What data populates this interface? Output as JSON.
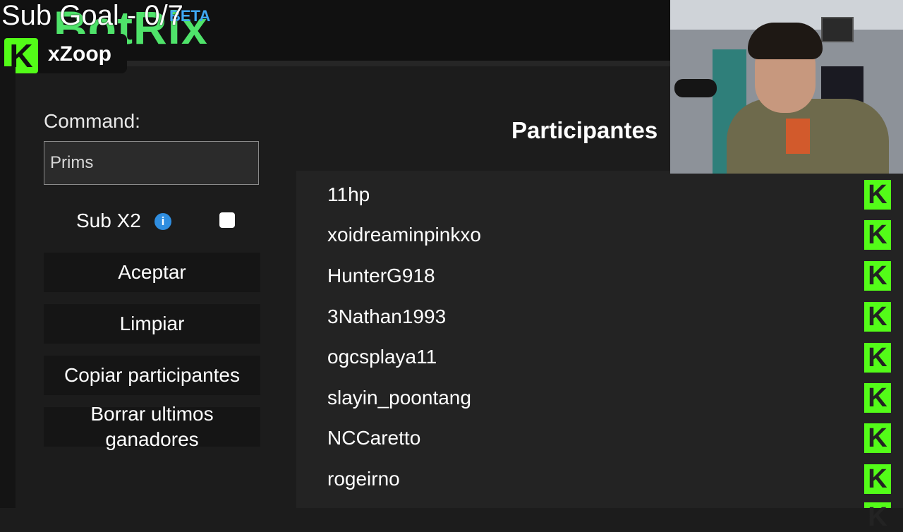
{
  "overlay": {
    "sub_goal": "Sub Goal - 0/7",
    "logo_text": "BotRix",
    "logo_badge": "BETA",
    "streamer_name": "xZoop",
    "kick_color": "#53fc18"
  },
  "form": {
    "command_label": "Command:",
    "command_value": "Prims",
    "sub_x2_label": "Sub X2",
    "sub_x2_checked": false,
    "info_icon": "info-icon"
  },
  "buttons": {
    "accept": "Aceptar",
    "clear": "Limpiar",
    "copy": "Copiar participantes",
    "delete_line1": "Borrar ultimos",
    "delete_line2": "ganadores"
  },
  "participants": {
    "title": "Participantes",
    "items": [
      "11hp",
      "xoidreaminpinkxo",
      "HunterG918",
      "3Nathan1993",
      "ogcsplaya11",
      "slayin_poontang",
      "NCCaretto",
      "rogeirno"
    ]
  },
  "colors": {
    "background": "#1c1c1c",
    "panel": "#232323",
    "button": "#151515",
    "accent_green": "#53fc18",
    "info_blue": "#2f8ee0"
  }
}
